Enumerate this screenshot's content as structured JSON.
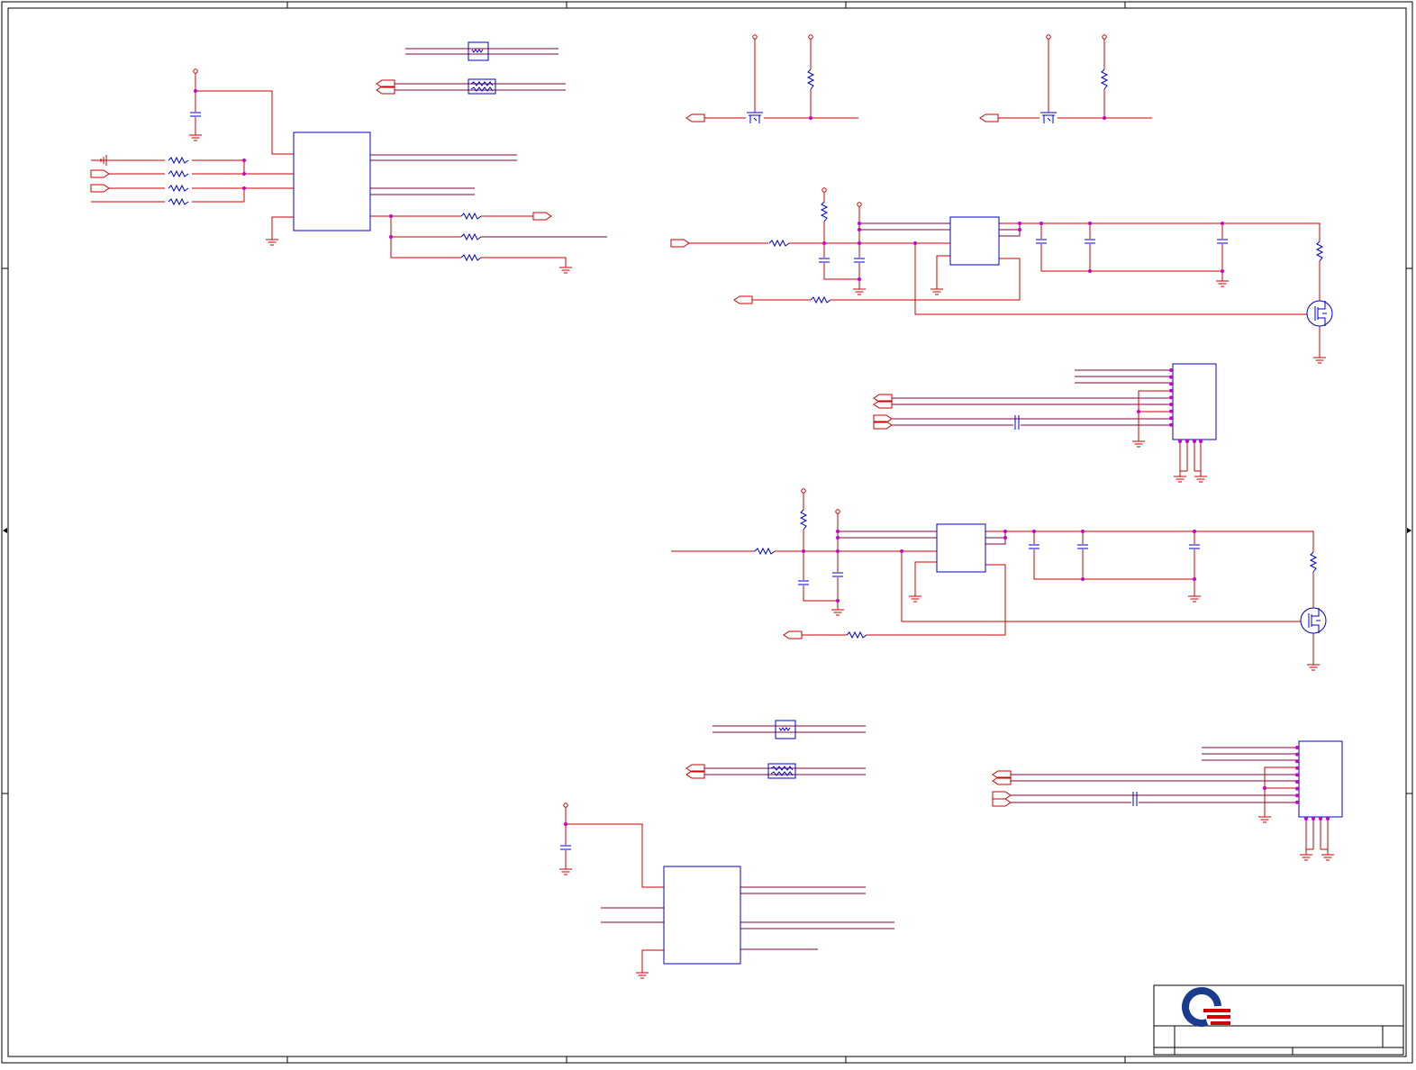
{
  "document": {
    "type": "electrical schematic sheet",
    "visible_text": []
  },
  "title_block": {
    "logo": "quanta-logo",
    "fields": []
  },
  "colors": {
    "wire": "#cc0000",
    "component": "#0000cc",
    "net_wire": "#800040",
    "junction": "#cc00cc",
    "frame": "#000000",
    "logo_blue": "#1a3c8c",
    "logo_red": "#d40000"
  },
  "icons": [
    "ground-symbol",
    "power-port",
    "resistor",
    "capacitor",
    "mosfet",
    "ferrite-bead",
    "off-page-connector",
    "ic-package",
    "connector-header"
  ]
}
